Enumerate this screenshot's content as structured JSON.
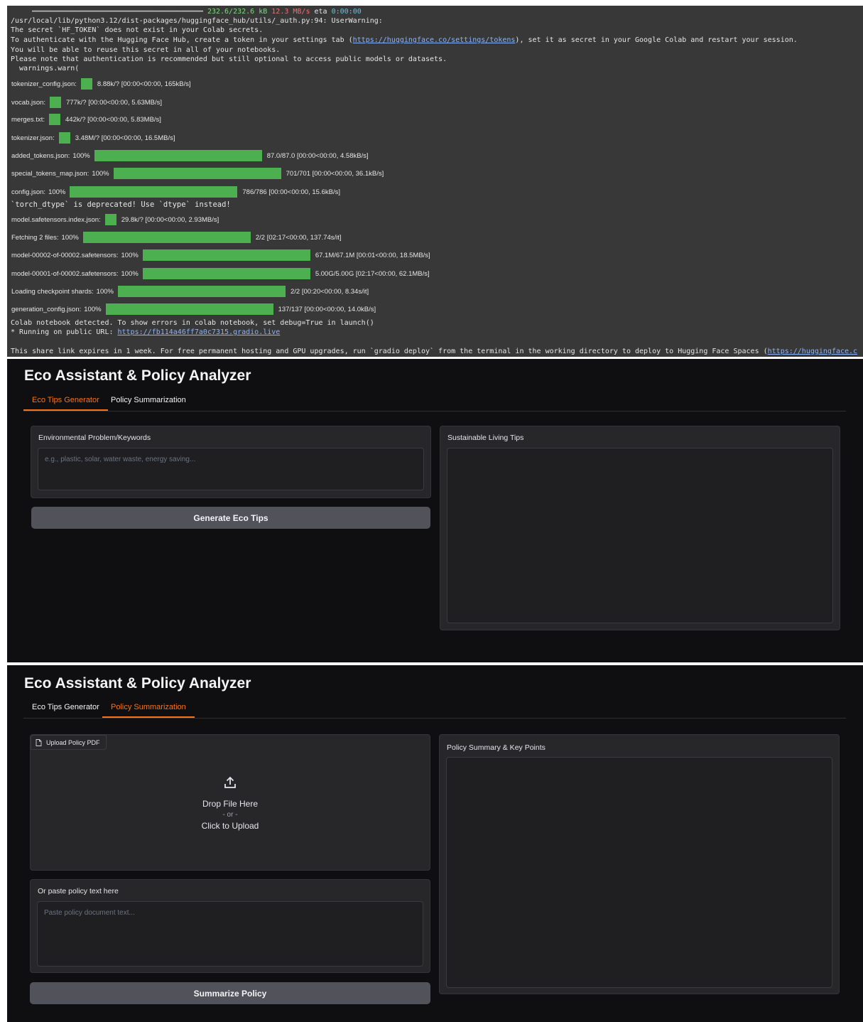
{
  "terminal": {
    "progress_header": {
      "size": "232.6/232.6 kB",
      "speed": "12.3 MB/s",
      "eta_label": "eta",
      "eta": "0:00:00"
    },
    "log_lines": [
      "/usr/local/lib/python3.12/dist-packages/huggingface_hub/utils/_auth.py:94: UserWarning:",
      "The secret `HF_TOKEN` does not exist in your Colab secrets."
    ],
    "auth_line": {
      "prefix": "To authenticate with the Hugging Face Hub, create a token in your settings tab (",
      "link": "https://huggingface.co/settings/tokens",
      "suffix": "), set it as secret in your Google Colab and restart your session."
    },
    "log_lines2": [
      "You will be able to reuse this secret in all of your notebooks.",
      "Please note that authentication is recommended but still optional to access public models or datasets.",
      "  warnings.warn("
    ],
    "progress": [
      {
        "label": "tokenizer_config.json:",
        "pct": "",
        "fill": 0.07,
        "stats": "8.88k/? [00:00<00:00, 165kB/s]"
      },
      {
        "label": "vocab.json:",
        "pct": "",
        "fill": 0.07,
        "stats": "777k/? [00:00<00:00, 5.63MB/s]"
      },
      {
        "label": "merges.txt:",
        "pct": "",
        "fill": 0.07,
        "stats": "442k/? [00:00<00:00, 5.83MB/s]"
      },
      {
        "label": "tokenizer.json:",
        "pct": "",
        "fill": 0.07,
        "stats": "3.48M/? [00:00<00:00, 16.5MB/s]"
      },
      {
        "label": "added_tokens.json:",
        "pct": "100%",
        "fill": 1.0,
        "stats": "87.0/87.0 [00:00<00:00, 4.58kB/s]"
      },
      {
        "label": "special_tokens_map.json:",
        "pct": "100%",
        "fill": 1.0,
        "stats": "701/701 [00:00<00:00, 36.1kB/s]"
      },
      {
        "label": "config.json:",
        "pct": "100%",
        "fill": 1.0,
        "stats": "786/786 [00:00<00:00, 15.6kB/s]"
      }
    ],
    "torch_warning": "`torch_dtype` is deprecated! Use `dtype` instead!",
    "progress2": [
      {
        "label": "model.safetensors.index.json:",
        "pct": "",
        "fill": 0.07,
        "stats": "29.8k/? [00:00<00:00, 2.93MB/s]"
      },
      {
        "label": "Fetching 2 files:",
        "pct": "100%",
        "fill": 1.0,
        "stats": "2/2 [02:17<00:00, 137.74s/it]"
      },
      {
        "label": "model-00002-of-00002.safetensors:",
        "pct": "100%",
        "fill": 1.0,
        "stats": "67.1M/67.1M [00:01<00:00, 18.5MB/s]"
      },
      {
        "label": "model-00001-of-00002.safetensors:",
        "pct": "100%",
        "fill": 1.0,
        "stats": "5.00G/5.00G [02:17<00:00, 62.1MB/s]"
      },
      {
        "label": "Loading checkpoint shards:",
        "pct": "100%",
        "fill": 1.0,
        "stats": "2/2 [00:20<00:00, 8.34s/it]"
      },
      {
        "label": "generation_config.json:",
        "pct": "100%",
        "fill": 1.0,
        "stats": "137/137 [00:00<00:00, 14.0kB/s]"
      }
    ],
    "colab_line": "Colab notebook detected. To show errors in colab notebook, set debug=True in launch()",
    "public_url": {
      "prefix": "* Running on public URL: ",
      "link": "https://fb114a46ff7a0c7315.gradio.live"
    },
    "share_line": {
      "prefix": "This share link expires in 1 week. For free permanent hosting and GPU upgrades, run `gradio deploy` from the terminal in the working directory to deploy to Hugging Face Spaces (",
      "link": "https://huggingface.c"
    }
  },
  "app": {
    "title": "Eco Assistant & Policy Analyzer",
    "tabs": [
      "Eco Tips Generator",
      "Policy Summarization"
    ]
  },
  "eco_tab": {
    "input_label": "Environmental Problem/Keywords",
    "input_placeholder": "e.g., plastic, solar, water waste, energy saving...",
    "button": "Generate Eco Tips",
    "output_label": "Sustainable Living Tips"
  },
  "policy_tab": {
    "upload_label": "Upload Policy PDF",
    "drop_text": "Drop File Here",
    "or_text": "- or -",
    "click_text": "Click to Upload",
    "paste_label": "Or paste policy text here",
    "paste_placeholder": "Paste policy document text...",
    "button": "Summarize Policy",
    "output_label": "Policy Summary & Key Points"
  },
  "colors": {
    "accent": "#f97316",
    "progress_green": "#4caf50",
    "terminal_bg": "#383838",
    "app_bg": "#0f0f11"
  }
}
